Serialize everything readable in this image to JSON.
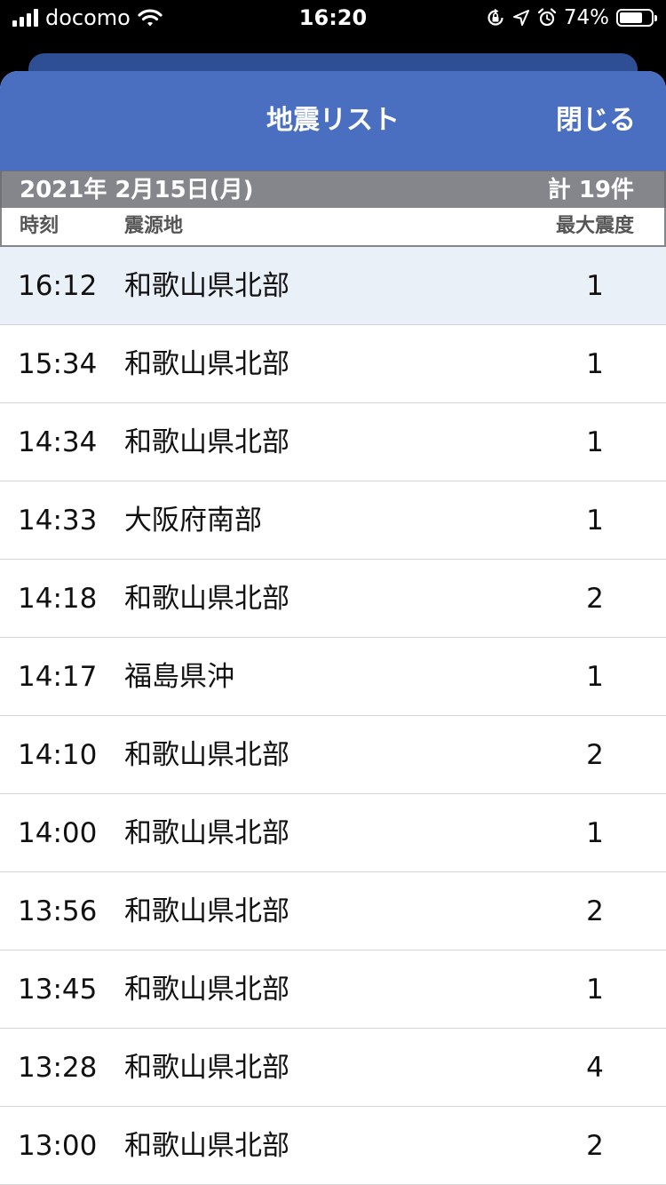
{
  "status_bar": {
    "carrier": "docomo",
    "time": "16:20",
    "battery_percent": "74%",
    "battery_level": 0.74,
    "icons": [
      "signal-bars-icon",
      "wifi-icon",
      "orientation-lock-icon",
      "location-arrow-icon",
      "alarm-icon",
      "battery-icon"
    ]
  },
  "navbar": {
    "title": "地震リスト",
    "close_label": "閉じる"
  },
  "list_header": {
    "date": "2021年 2月15日(月)",
    "total": "計 19件",
    "col_time": "時刻",
    "col_place": "震源地",
    "col_intensity": "最大震度"
  },
  "rows": [
    {
      "time": "16:12",
      "place": "和歌山県北部",
      "intensity": "1"
    },
    {
      "time": "15:34",
      "place": "和歌山県北部",
      "intensity": "1"
    },
    {
      "time": "14:34",
      "place": "和歌山県北部",
      "intensity": "1"
    },
    {
      "time": "14:33",
      "place": "大阪府南部",
      "intensity": "1"
    },
    {
      "time": "14:18",
      "place": "和歌山県北部",
      "intensity": "2"
    },
    {
      "time": "14:17",
      "place": "福島県沖",
      "intensity": "1"
    },
    {
      "time": "14:10",
      "place": "和歌山県北部",
      "intensity": "2"
    },
    {
      "time": "14:00",
      "place": "和歌山県北部",
      "intensity": "1"
    },
    {
      "time": "13:56",
      "place": "和歌山県北部",
      "intensity": "2"
    },
    {
      "time": "13:45",
      "place": "和歌山県北部",
      "intensity": "1"
    },
    {
      "time": "13:28",
      "place": "和歌山県北部",
      "intensity": "4"
    },
    {
      "time": "13:00",
      "place": "和歌山県北部",
      "intensity": "2"
    }
  ],
  "colors": {
    "navbar": "#4a6fc0",
    "date_header": "#85868c",
    "selected_row": "#eaf0f8"
  }
}
